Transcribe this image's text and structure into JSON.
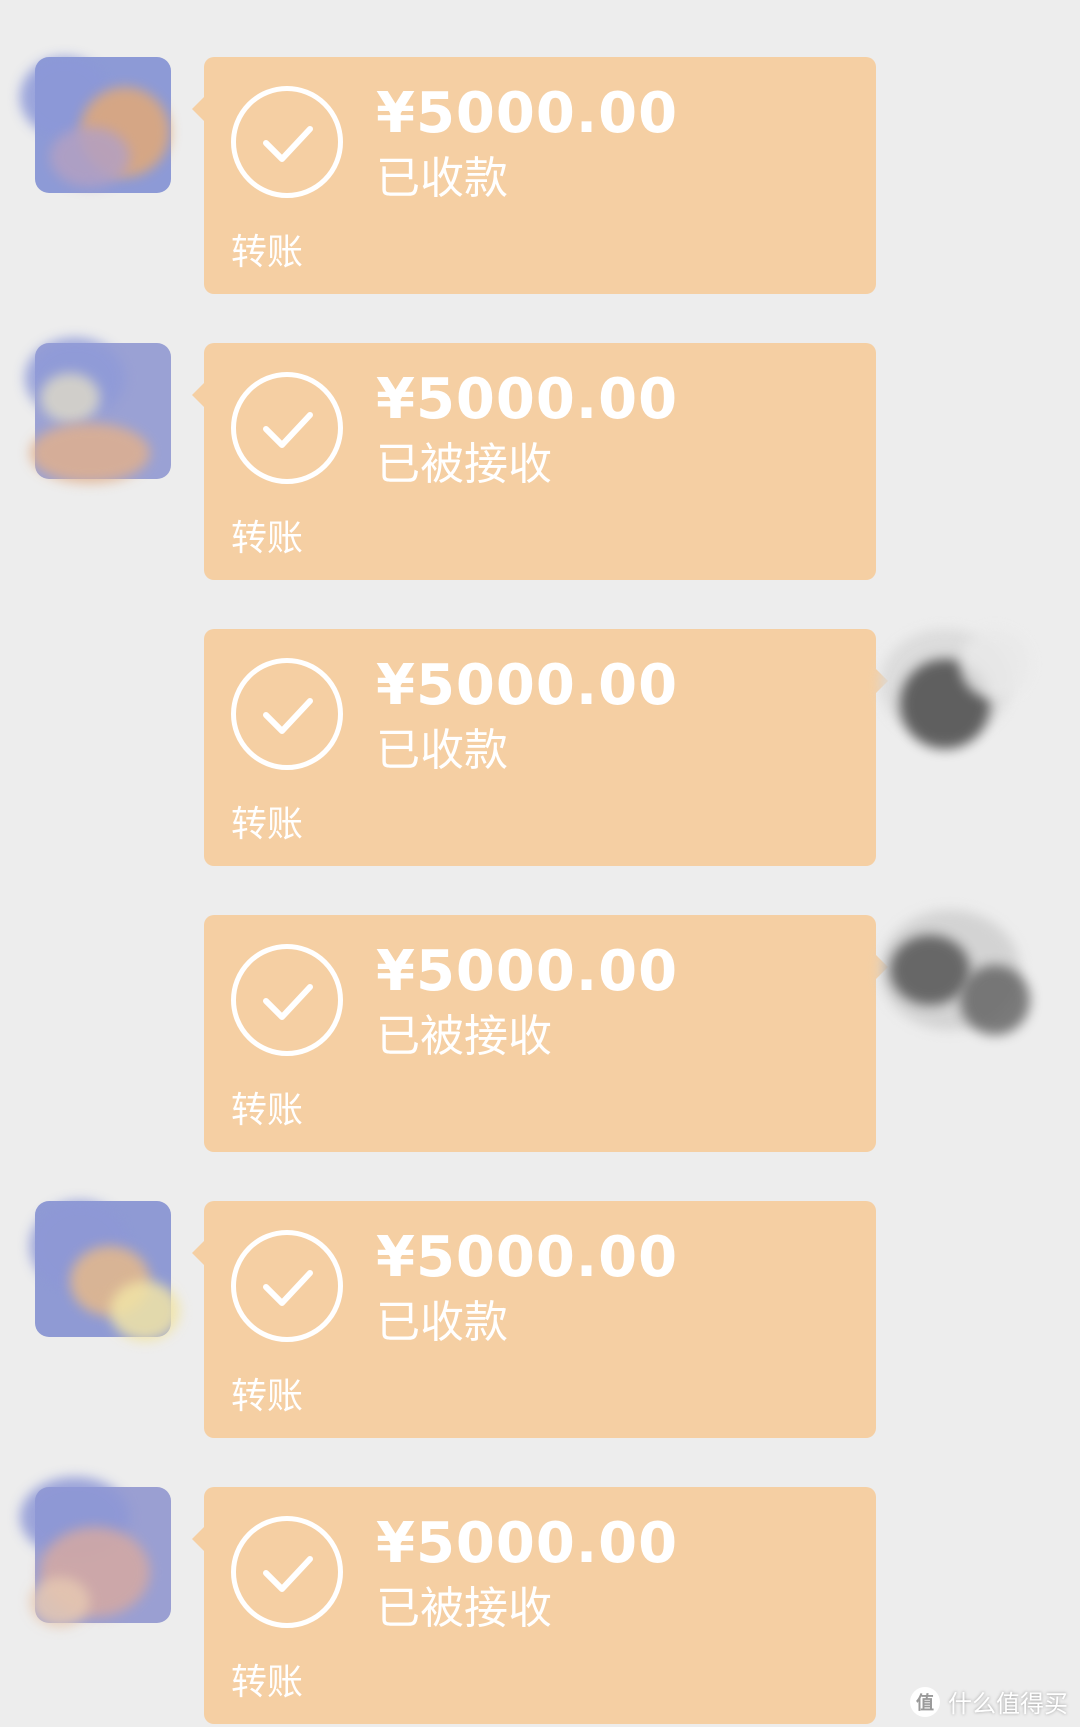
{
  "messages": [
    {
      "side": "left",
      "amount": "¥5000.00",
      "status": "已收款",
      "type": "转账"
    },
    {
      "side": "left",
      "amount": "¥5000.00",
      "status": "已被接收",
      "type": "转账"
    },
    {
      "side": "right",
      "amount": "¥5000.00",
      "status": "已收款",
      "type": "转账"
    },
    {
      "side": "right",
      "amount": "¥5000.00",
      "status": "已被接收",
      "type": "转账"
    },
    {
      "side": "left",
      "amount": "¥5000.00",
      "status": "已收款",
      "type": "转账"
    },
    {
      "side": "left",
      "amount": "¥5000.00",
      "status": "已被接收",
      "type": "转账"
    }
  ],
  "watermark": {
    "icon": "zhi-badge-icon",
    "text": "什么值得买"
  },
  "colors": {
    "background": "#ededed",
    "bubble": "#f5cfa3",
    "text": "#ffffff"
  }
}
